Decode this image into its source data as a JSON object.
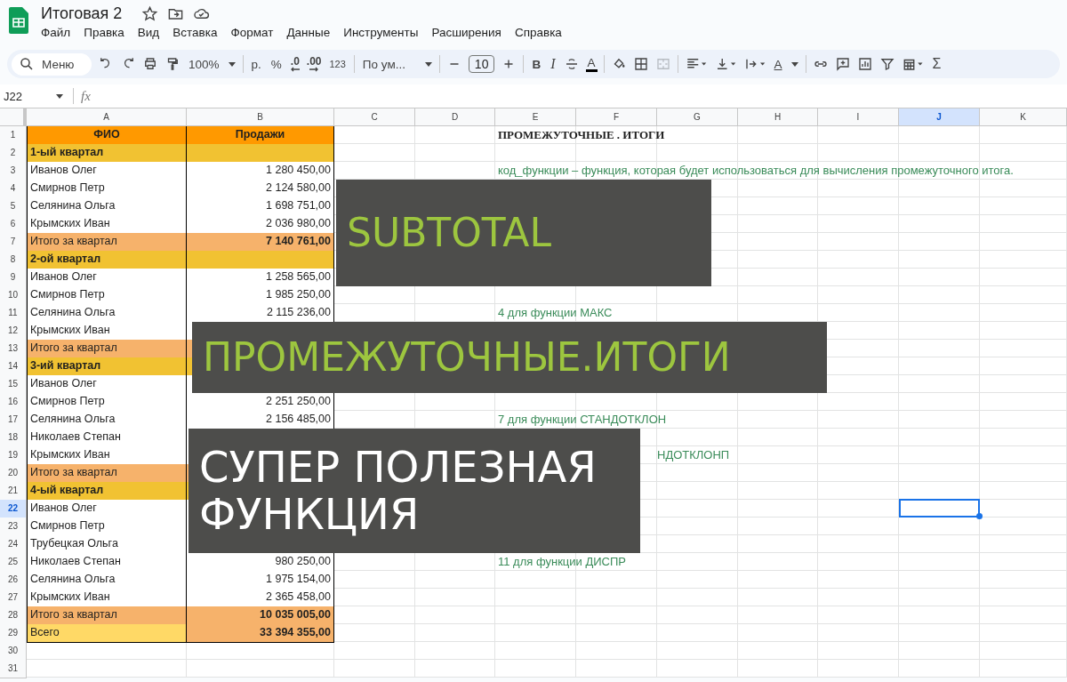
{
  "document": {
    "title": "Итоговая 2"
  },
  "menu": [
    "Файл",
    "Правка",
    "Вид",
    "Вставка",
    "Формат",
    "Данные",
    "Инструменты",
    "Расширения",
    "Справка"
  ],
  "toolbar": {
    "search_placeholder": "Меню",
    "zoom": "100%",
    "currency": "р.",
    "percent": "%",
    "dec_less": ".0",
    "dec_more": ".00",
    "format": "123",
    "font": "По ум...",
    "font_size": "10",
    "bold": "B",
    "italic": "I",
    "text_color": "A",
    "rotate": "A",
    "sum": "Σ"
  },
  "formula_bar": {
    "cell": "J22",
    "fx": "fx"
  },
  "columns": [
    {
      "label": "A",
      "selected": false
    },
    {
      "label": "B",
      "selected": false
    },
    {
      "label": "C",
      "selected": false
    },
    {
      "label": "D",
      "selected": false
    },
    {
      "label": "E",
      "selected": false
    },
    {
      "label": "F",
      "selected": false
    },
    {
      "label": "G",
      "selected": false
    },
    {
      "label": "H",
      "selected": false
    },
    {
      "label": "I",
      "selected": false
    },
    {
      "label": "J",
      "selected": true
    },
    {
      "label": "K",
      "selected": false
    }
  ],
  "rows": [
    {
      "num": "1",
      "kind": "header",
      "a": "ФИО",
      "b": "Продажи",
      "note": {
        "kind": "title",
        "text": "ПРОМЕЖУТОЧНЫЕ . ИТОГИ"
      },
      "selected": false
    },
    {
      "num": "2",
      "kind": "quarter",
      "a": "1-ый квартал",
      "selected": false
    },
    {
      "num": "3",
      "kind": "item",
      "a": "Иванов Олег",
      "b": "1 280 450,00",
      "note": {
        "kind": "code",
        "text": "код_функции – функция, которая будет использоваться для вычисления промежуточного итога."
      },
      "selected": false
    },
    {
      "num": "4",
      "kind": "item",
      "a": "Смирнов Петр",
      "b": "2 124 580,00",
      "selected": false
    },
    {
      "num": "5",
      "kind": "item",
      "a": "Селянина Ольга",
      "b": "1 698 751,00",
      "selected": false
    },
    {
      "num": "6",
      "kind": "item",
      "a": "Крымских Иван",
      "b": "2 036 980,00",
      "selected": false
    },
    {
      "num": "7",
      "kind": "subtotal",
      "a": "Итого за квартал",
      "b": "7 140 761,00",
      "selected": false
    },
    {
      "num": "8",
      "kind": "quarter",
      "a": "2-ой квартал",
      "selected": false
    },
    {
      "num": "9",
      "kind": "item",
      "a": "Иванов Олег",
      "b": "1 258 565,00",
      "selected": false
    },
    {
      "num": "10",
      "kind": "item",
      "a": "Смирнов Петр",
      "b": "1 985 250,00",
      "selected": false
    },
    {
      "num": "11",
      "kind": "item",
      "a": "Селянина Ольга",
      "b": "2 115 236,00",
      "note": {
        "kind": "code",
        "text": "4 для функции МАКС"
      },
      "selected": false
    },
    {
      "num": "12",
      "kind": "item",
      "a": "Крымских Иван",
      "selected": false
    },
    {
      "num": "13",
      "kind": "subtotal",
      "a": "Итого за квартал",
      "selected": false
    },
    {
      "num": "14",
      "kind": "quarter",
      "a": "3-ий квартал",
      "selected": false
    },
    {
      "num": "15",
      "kind": "item",
      "a": "Иванов Олег",
      "selected": false
    },
    {
      "num": "16",
      "kind": "item",
      "a": "Смирнов Петр",
      "b": "2 251 250,00",
      "selected": false
    },
    {
      "num": "17",
      "kind": "item",
      "a": "Селянина Ольга",
      "b": "2 156 485,00",
      "note": {
        "kind": "code",
        "text": "7 для функции СТАНДОТКЛОН"
      },
      "selected": false
    },
    {
      "num": "18",
      "kind": "item",
      "a": "Николаев Степан",
      "selected": false
    },
    {
      "num": "19",
      "kind": "item",
      "a": "Крымских Иван",
      "note": {
        "kind": "tail",
        "text": "НДОТКЛОНП"
      },
      "selected": false
    },
    {
      "num": "20",
      "kind": "subtotal",
      "a": "Итого за квартал",
      "selected": false
    },
    {
      "num": "21",
      "kind": "quarter",
      "a": "4-ый квартал",
      "selected": false
    },
    {
      "num": "22",
      "kind": "item",
      "a": "Иванов Олег",
      "selected": true
    },
    {
      "num": "23",
      "kind": "item",
      "a": "Смирнов Петр",
      "selected": false
    },
    {
      "num": "24",
      "kind": "item",
      "a": "Трубецкая Ольга",
      "selected": false
    },
    {
      "num": "25",
      "kind": "item",
      "a": "Николаев Степан",
      "b": "980 250,00",
      "note": {
        "kind": "code",
        "text": "11 для функции ДИСПР"
      },
      "selected": false
    },
    {
      "num": "26",
      "kind": "item",
      "a": "Селянина Ольга",
      "b": "1 975 154,00",
      "selected": false
    },
    {
      "num": "27",
      "kind": "item",
      "a": "Крымских Иван",
      "b": "2 365 458,00",
      "selected": false
    },
    {
      "num": "28",
      "kind": "subtotal",
      "a": "Итого за квартал",
      "b": "10 035 005,00",
      "selected": false
    },
    {
      "num": "29",
      "kind": "total",
      "a": "Всего",
      "b": "33 394 355,00",
      "selected": false
    },
    {
      "num": "30",
      "kind": "blank",
      "selected": false
    },
    {
      "num": "31",
      "kind": "blank",
      "selected": false
    }
  ],
  "banners": [
    {
      "kind": "accent",
      "lines": [
        "SUBTOTAL"
      ]
    },
    {
      "kind": "accent",
      "lines": [
        "ПРОМЕЖУТОЧНЫЕ.ИТОГИ"
      ]
    },
    {
      "kind": "plain",
      "lines": [
        "СУПЕР ПОЛЕЗНАЯ",
        "ФУНКЦИЯ"
      ]
    }
  ]
}
